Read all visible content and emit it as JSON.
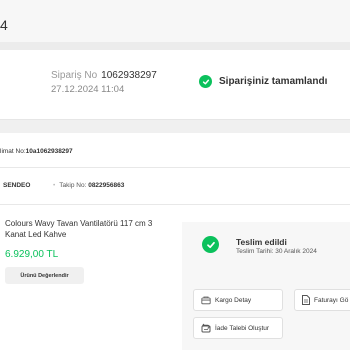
{
  "page": {
    "title": "4"
  },
  "order": {
    "no_label": "Sipariş No",
    "no_value": "1062938297",
    "date": "27.12.2024 11:04",
    "status": "Siparişiniz tamamlandı"
  },
  "package": {
    "instruction_label": "limat No:",
    "instruction_value": "10a1062938297",
    "carrier": "SENDEO",
    "tracking_label": "Takip No:",
    "tracking_value": "0822956863"
  },
  "product": {
    "name": "Colours Wavy Tavan Vantilatörü 117 cm 3 Kanat Led Kahve",
    "price": "6.929,00 TL",
    "review_button": "Ürünü Değerlendir"
  },
  "delivery": {
    "status": "Teslim edildi",
    "date_label": "Teslim Tarihi: 30 Aralık 2024",
    "actions": {
      "cargo": "Kargo Detay",
      "invoice": "Faturayı Gö",
      "return": "İade Talebi Oluştur"
    }
  },
  "colors": {
    "success": "#0bc15c",
    "muted_bg": "#f7f7f7"
  },
  "icons": {
    "status": "check-circle-icon",
    "cargo": "truck-icon",
    "invoice": "document-icon",
    "return": "return-icon"
  }
}
